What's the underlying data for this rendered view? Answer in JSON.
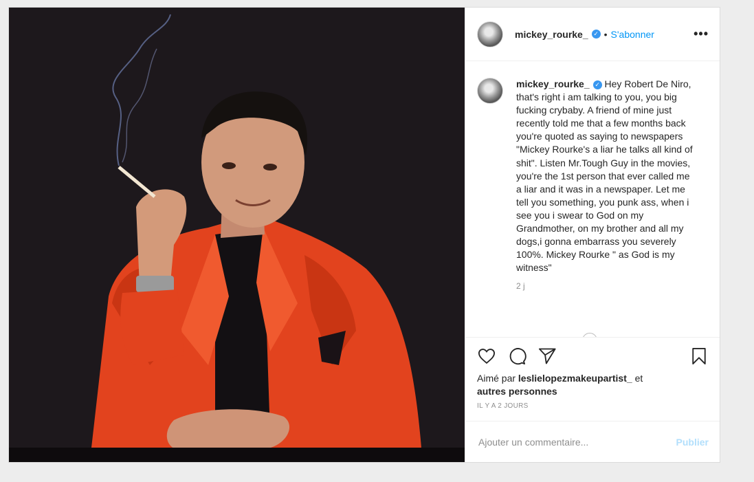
{
  "post": {
    "username": "mickey_rourke_",
    "follow_label": "S'abonner",
    "header_separator": "•",
    "more_label": "•••",
    "verified_icon": "verified-badge-icon",
    "caption": "Hey Robert De Niro, that's right i am talking to you, you big fucking crybaby. A friend of mine just recently told me that a few months back you're quoted as saying to newspapers \"Mickey Rourke's a liar he talks all kind of shit\". Listen Mr.Tough Guy in the movies, you're the 1st person that ever called me a liar and it was in a newspaper. Let me tell you something, you punk ass, when i see you i swear to God on my Grandmother, on my brother and all my dogs,i gonna embarrass you severely 100%. Mickey Rourke \" as God is my witness\"",
    "caption_age": "2 j",
    "likes_prefix": "Aimé par",
    "liked_by": "leslielopezmakeupartist_",
    "likes_conj": "et",
    "likes_others": "autres personnes",
    "timestamp": "IL Y A 2 JOURS",
    "comment_placeholder": "Ajouter un commentaire...",
    "publish_label": "Publier"
  },
  "colors": {
    "accent": "#0095f6",
    "publish_disabled": "#b2dffc",
    "verified": "#3897f0",
    "jacket": "#e8441f"
  }
}
